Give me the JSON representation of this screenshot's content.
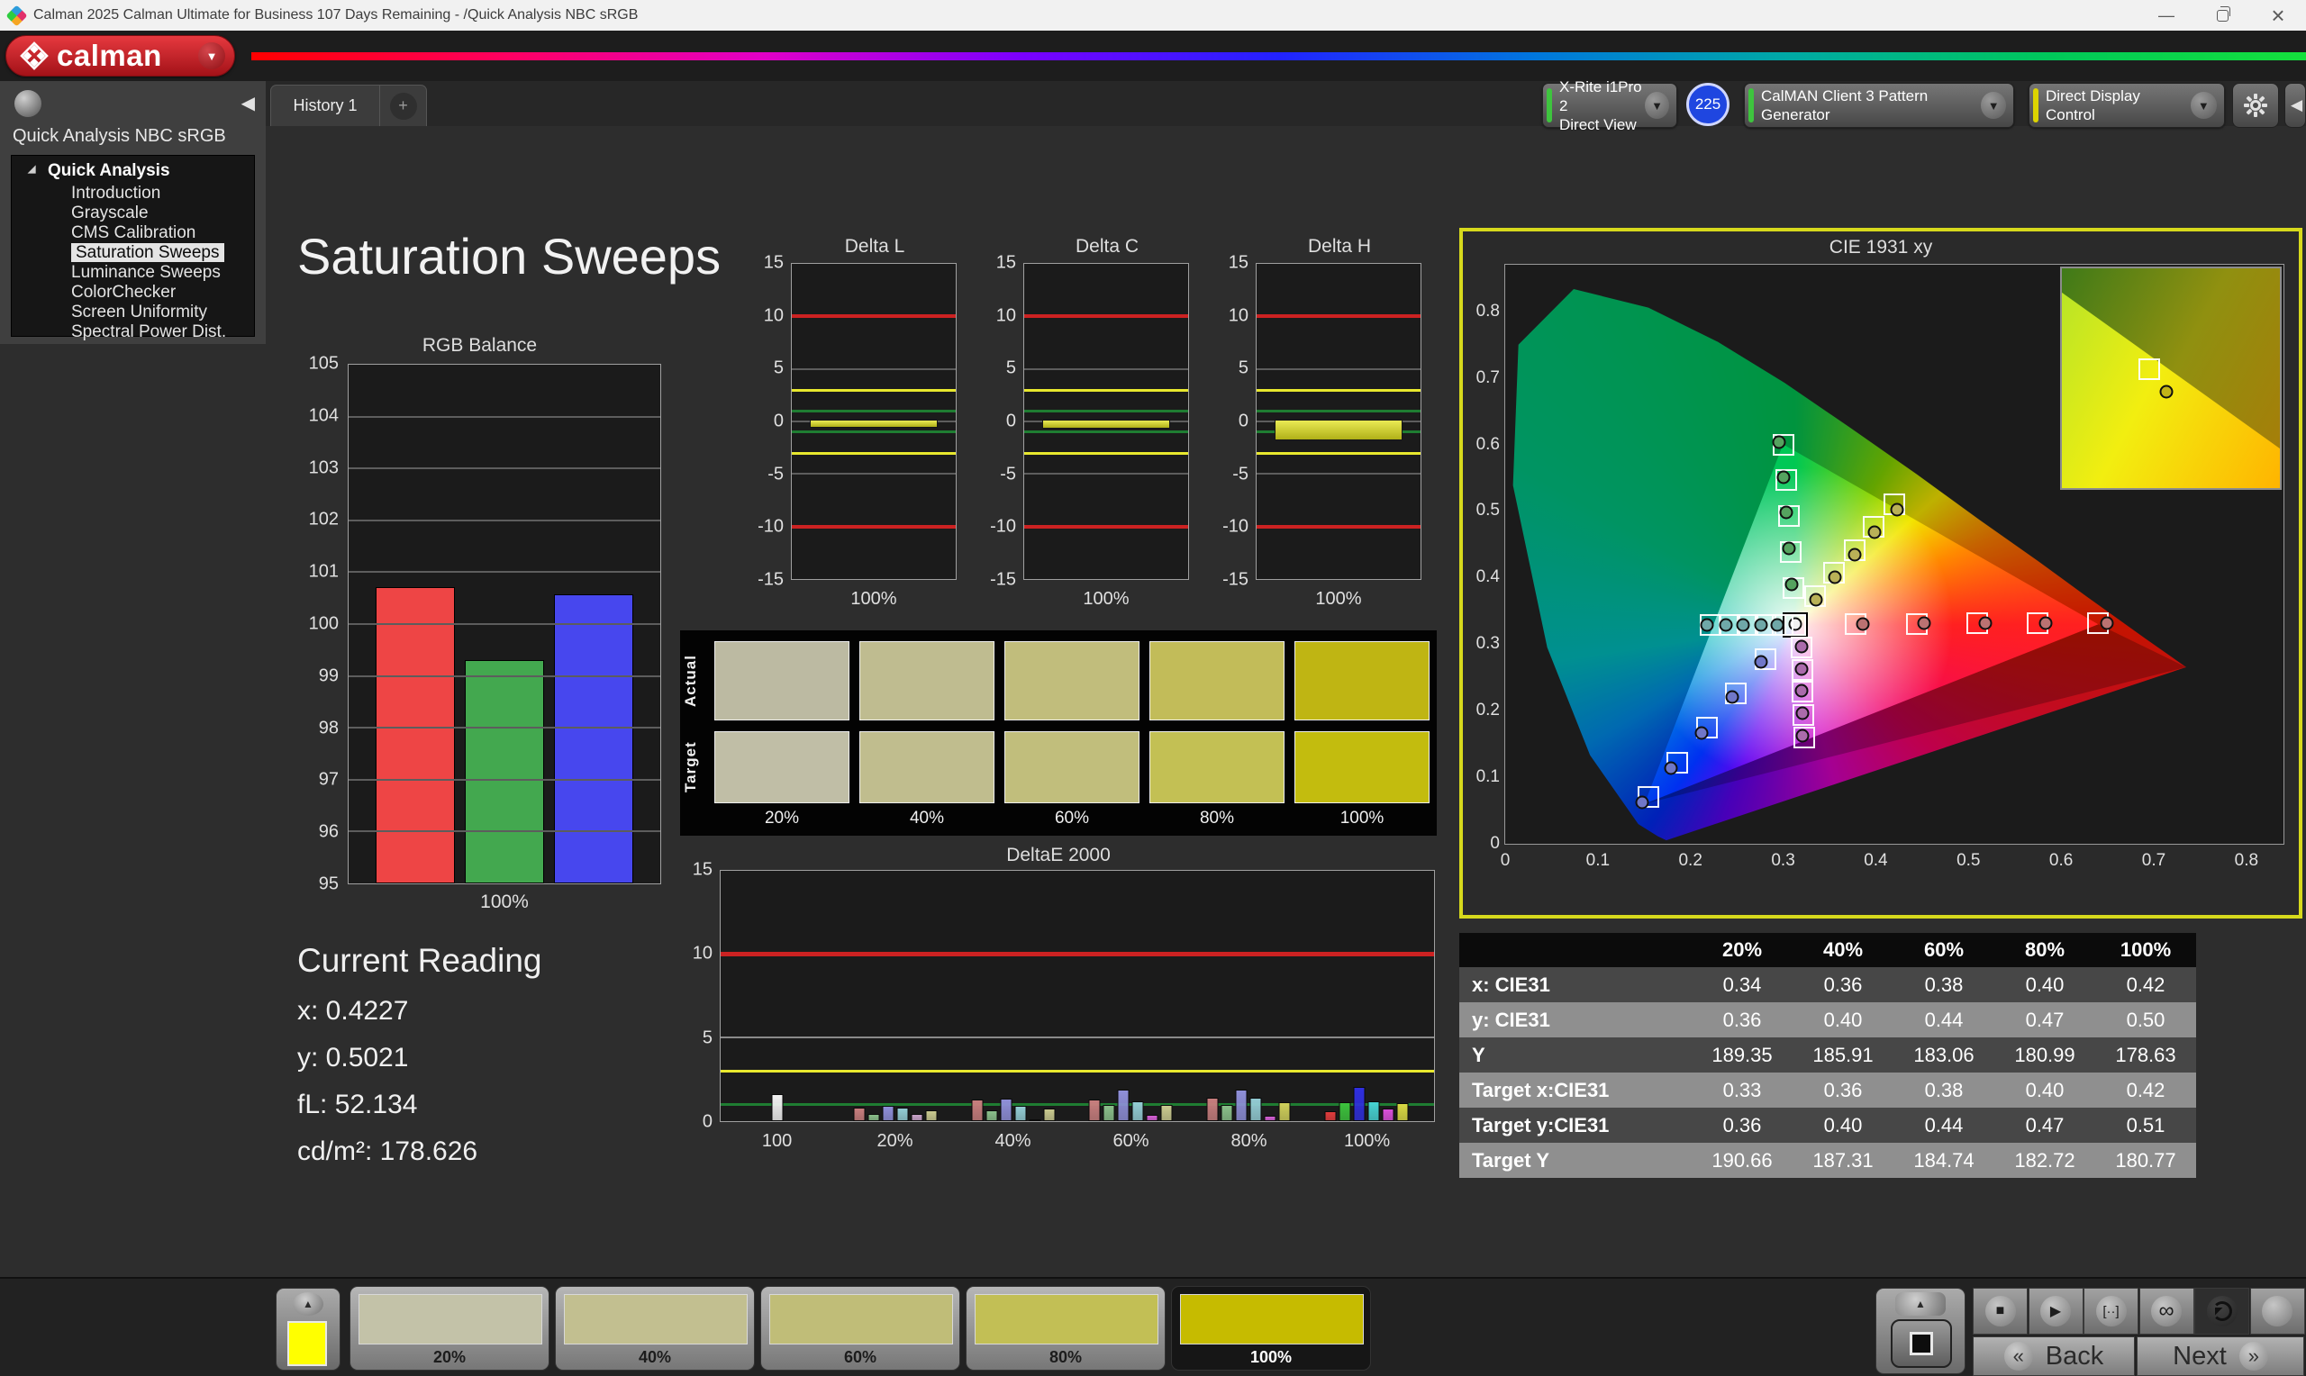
{
  "window": {
    "title": "Calman 2025 Calman Ultimate for Business 107 Days Remaining  - /Quick Analysis NBC sRGB",
    "minimize": "—",
    "close": "×"
  },
  "header": {
    "logo_text": "calman",
    "caret": "▼"
  },
  "tab_bar": {
    "history_tab": "History 1",
    "add_tab": "+"
  },
  "toolbar": {
    "meter": {
      "line1": "X-Rite i1Pro 2",
      "line2": "Direct View",
      "badge": "225",
      "accent": "#3ec43e",
      "caret": "▼"
    },
    "pattern_generator": {
      "label": "CalMAN Client 3 Pattern Generator",
      "accent": "#3ec43e",
      "caret": "▼"
    },
    "display_control": {
      "label": "Direct Display Control",
      "accent": "#ddd400",
      "caret": "▼"
    },
    "collapse_arrow": "◀"
  },
  "sidebar": {
    "workflow_title": "Quick Analysis NBC sRGB",
    "root_item": "Quick Analysis",
    "collapse_arrow": "◀",
    "items": [
      "Introduction",
      "Grayscale",
      "CMS Calibration",
      "Saturation Sweeps",
      "Luminance Sweeps",
      "ColorChecker",
      "Screen Uniformity",
      "Spectral Power Dist."
    ],
    "selected_index": 3
  },
  "page": {
    "title": "Saturation Sweeps"
  },
  "current_reading": {
    "title": "Current Reading",
    "readings": [
      {
        "label": "x",
        "value": "0.4227"
      },
      {
        "label": "y",
        "value": "0.5021"
      },
      {
        "label": "fL",
        "value": "52.134"
      },
      {
        "label": "cd/m²",
        "value": "178.626"
      }
    ]
  },
  "swatch_panel": {
    "row_labels": [
      "Actual",
      "Target"
    ],
    "col_labels": [
      "20%",
      "40%",
      "60%",
      "80%",
      "100%"
    ],
    "actual_colors": [
      "#bcbaa2",
      "#bfbc90",
      "#c1bd7c",
      "#c2bc59",
      "#bfb513"
    ],
    "target_colors": [
      "#c0bea6",
      "#c0bd8e",
      "#c1be7c",
      "#c3c054",
      "#c3bc0e"
    ]
  },
  "pattern_bar": {
    "preview_color": "#ffff00",
    "buttons": [
      {
        "label": "20%",
        "color": "#c3c2a8",
        "selected": false
      },
      {
        "label": "40%",
        "color": "#c2bf90",
        "selected": false
      },
      {
        "label": "60%",
        "color": "#c0bd78",
        "selected": false
      },
      {
        "label": "80%",
        "color": "#c2bf55",
        "selected": false
      },
      {
        "label": "100%",
        "color": "#c6bb00",
        "selected": true
      }
    ],
    "transport": [
      {
        "name": "stop-button",
        "glyph": "■"
      },
      {
        "name": "play-button",
        "glyph": "▶"
      },
      {
        "name": "step-button",
        "glyph": "[··]"
      },
      {
        "name": "loop-button",
        "glyph": "∞"
      },
      {
        "name": "sync-button",
        "glyph": "sync"
      },
      {
        "name": "pattern-window-button",
        "glyph": ""
      }
    ],
    "back_label": "Back",
    "next_label": "Next",
    "back_chevron": "«",
    "next_chevron": "»"
  },
  "chart_data": [
    {
      "id": "rgb_balance",
      "type": "bar",
      "title": "RGB Balance",
      "categories": [
        "Red",
        "Green",
        "Blue"
      ],
      "values": [
        100.72,
        99.3,
        100.58
      ],
      "colors": [
        "#ee4545",
        "#43a84f",
        "#4747ee"
      ],
      "ylim": [
        95,
        105
      ],
      "yticks": [
        "105",
        "104",
        "103",
        "102",
        "101",
        "100",
        "99",
        "98",
        "97",
        "96",
        "95"
      ],
      "xlabel": "100%"
    },
    {
      "id": "delta_trio",
      "type": "bar",
      "charts": [
        {
          "title": "Delta L",
          "value": -0.4
        },
        {
          "title": "Delta C",
          "value": -0.5
        },
        {
          "title": "Delta H",
          "value": -1.65
        }
      ],
      "ylim": [
        -15,
        15
      ],
      "yticks": [
        "15",
        "10",
        "5",
        "0",
        "-5",
        "-10",
        "-15"
      ],
      "limit_lines": {
        "red": 10,
        "yellow": 3,
        "green": 1
      },
      "xlabel": "100%"
    },
    {
      "id": "deltae2000",
      "type": "bar",
      "title": "DeltaE 2000",
      "ylim": [
        0,
        15
      ],
      "yticks": [
        "15",
        "10",
        "5",
        "0"
      ],
      "limit_lines": {
        "red": 10,
        "gray": 5,
        "yellow": 3,
        "green": 1
      },
      "group_centers": [
        8,
        24.5,
        41,
        57.5,
        74,
        90.5
      ],
      "groups": [
        {
          "label": "100",
          "colors": [
            "#f2f2f2"
          ],
          "values": [
            1.6
          ]
        },
        {
          "label": "20%",
          "colors": [
            "#c87e7e",
            "#8abf8a",
            "#8f8fd9",
            "#93ccd4",
            "#c9a3c9",
            "#c9c98f"
          ],
          "values": [
            0.8,
            0.45,
            0.9,
            0.8,
            0.45,
            0.65
          ]
        },
        {
          "label": "40%",
          "colors": [
            "#c87e7e",
            "#8abf8a",
            "#8f8fd9",
            "#93ccd4",
            "#c9a3c9",
            "#c9c98f"
          ],
          "values": [
            1.3,
            0.65,
            1.35,
            0.9,
            0.1,
            0.75
          ]
        },
        {
          "label": "60%",
          "colors": [
            "#c87e7e",
            "#8abf8a",
            "#8f8fd9",
            "#93ccd4",
            "#d45fd4",
            "#c9c98f"
          ],
          "values": [
            1.3,
            0.95,
            1.85,
            1.2,
            0.4,
            0.95
          ]
        },
        {
          "label": "80%",
          "colors": [
            "#c87e7e",
            "#8abf8a",
            "#8f8fd9",
            "#93ccd4",
            "#d45fd4",
            "#cfcf5a"
          ],
          "values": [
            1.4,
            0.95,
            1.85,
            1.4,
            0.3,
            1.1
          ]
        },
        {
          "label": "100%",
          "colors": [
            "#e03c3c",
            "#3cc23c",
            "#2f2fe0",
            "#46d2d2",
            "#d94fd9",
            "#d9d943"
          ],
          "values": [
            0.6,
            1.1,
            2.05,
            1.2,
            0.75,
            1.05
          ]
        }
      ]
    },
    {
      "id": "cie",
      "type": "scatter",
      "title": "CIE 1931 xy",
      "xlim": [
        0,
        0.84
      ],
      "ylim": [
        0,
        0.87
      ],
      "xticks": [
        "0",
        "0.1",
        "0.2",
        "0.3",
        "0.4",
        "0.5",
        "0.6",
        "0.7",
        "0.8"
      ],
      "yticks": [
        "0.8",
        "0.7",
        "0.6",
        "0.5",
        "0.4",
        "0.3",
        "0.2",
        "0.1",
        "0"
      ],
      "gamut_triangle": {
        "red": [
          0.64,
          0.33
        ],
        "green": [
          0.3,
          0.6
        ],
        "blue": [
          0.15,
          0.06
        ]
      },
      "sweeps": [
        {
          "name": "white",
          "color": "#f2f2f2",
          "targets": [
            [
              0.3127,
              0.329
            ]
          ],
          "measured": [
            [
              0.313,
              0.33
            ]
          ]
        },
        {
          "name": "red",
          "color": "#bb7272",
          "targets": [
            [
              0.378,
              0.33
            ],
            [
              0.444,
              0.33
            ],
            [
              0.509,
              0.331
            ],
            [
              0.575,
              0.331
            ],
            [
              0.64,
              0.332
            ]
          ],
          "measured": [
            [
              0.386,
              0.33
            ],
            [
              0.452,
              0.331
            ],
            [
              0.518,
              0.331
            ],
            [
              0.583,
              0.332
            ],
            [
              0.649,
              0.332
            ]
          ]
        },
        {
          "name": "green",
          "color": "#55a35f",
          "targets": [
            [
              0.311,
              0.384
            ],
            [
              0.308,
              0.438
            ],
            [
              0.306,
              0.492
            ],
            [
              0.303,
              0.546
            ],
            [
              0.3,
              0.6
            ]
          ],
          "measured": [
            [
              0.309,
              0.39
            ],
            [
              0.306,
              0.444
            ],
            [
              0.303,
              0.498
            ],
            [
              0.3,
              0.551
            ],
            [
              0.296,
              0.603
            ]
          ]
        },
        {
          "name": "blue",
          "color": "#7077c8",
          "targets": [
            [
              0.281,
              0.278
            ],
            [
              0.249,
              0.226
            ],
            [
              0.218,
              0.174
            ],
            [
              0.186,
              0.122
            ],
            [
              0.155,
              0.07
            ]
          ],
          "measured": [
            [
              0.276,
              0.273
            ],
            [
              0.245,
              0.22
            ],
            [
              0.212,
              0.167
            ],
            [
              0.179,
              0.114
            ],
            [
              0.148,
              0.062
            ]
          ]
        },
        {
          "name": "cyan",
          "color": "#6fa8a8",
          "targets": [
            [
              0.222,
              0.329
            ],
            [
              0.242,
              0.329
            ],
            [
              0.262,
              0.329
            ],
            [
              0.281,
              0.329
            ],
            [
              0.299,
              0.329
            ]
          ],
          "measured": [
            [
              0.218,
              0.329
            ],
            [
              0.238,
              0.329
            ],
            [
              0.257,
              0.329
            ],
            [
              0.276,
              0.329
            ],
            [
              0.294,
              0.329
            ]
          ]
        },
        {
          "name": "magenta",
          "color": "#ab6bab",
          "targets": [
            [
              0.32,
              0.295
            ],
            [
              0.321,
              0.261
            ],
            [
              0.321,
              0.228
            ],
            [
              0.322,
              0.194
            ],
            [
              0.323,
              0.16
            ]
          ],
          "measured": [
            [
              0.32,
              0.296
            ],
            [
              0.32,
              0.263
            ],
            [
              0.32,
              0.23
            ],
            [
              0.321,
              0.196
            ],
            [
              0.321,
              0.163
            ]
          ]
        },
        {
          "name": "yellow",
          "color": "#b9b157",
          "targets": [
            [
              0.334,
              0.372
            ],
            [
              0.355,
              0.407
            ],
            [
              0.377,
              0.441
            ],
            [
              0.398,
              0.476
            ],
            [
              0.42,
              0.51
            ]
          ],
          "measured": [
            [
              0.335,
              0.367
            ],
            [
              0.356,
              0.4
            ],
            [
              0.377,
              0.434
            ],
            [
              0.399,
              0.468
            ],
            [
              0.423,
              0.502
            ]
          ]
        }
      ],
      "inset": {
        "square_pos": [
          40,
          46
        ],
        "circle_pos": [
          48,
          56
        ],
        "circle_color": "#c2b418"
      }
    },
    {
      "id": "sat_table",
      "type": "table",
      "columns": [
        "20%",
        "40%",
        "60%",
        "80%",
        "100%"
      ],
      "rows": [
        {
          "label": "x: CIE31",
          "values": [
            "0.34",
            "0.36",
            "0.38",
            "0.40",
            "0.42"
          ]
        },
        {
          "label": "y: CIE31",
          "values": [
            "0.36",
            "0.40",
            "0.44",
            "0.47",
            "0.50"
          ]
        },
        {
          "label": "Y",
          "values": [
            "189.35",
            "185.91",
            "183.06",
            "180.99",
            "178.63"
          ]
        },
        {
          "label": "Target x:CIE31",
          "values": [
            "0.33",
            "0.36",
            "0.38",
            "0.40",
            "0.42"
          ]
        },
        {
          "label": "Target y:CIE31",
          "values": [
            "0.36",
            "0.40",
            "0.44",
            "0.47",
            "0.51"
          ]
        },
        {
          "label": "Target Y",
          "values": [
            "190.66",
            "187.31",
            "184.74",
            "182.72",
            "180.77"
          ]
        }
      ]
    }
  ]
}
